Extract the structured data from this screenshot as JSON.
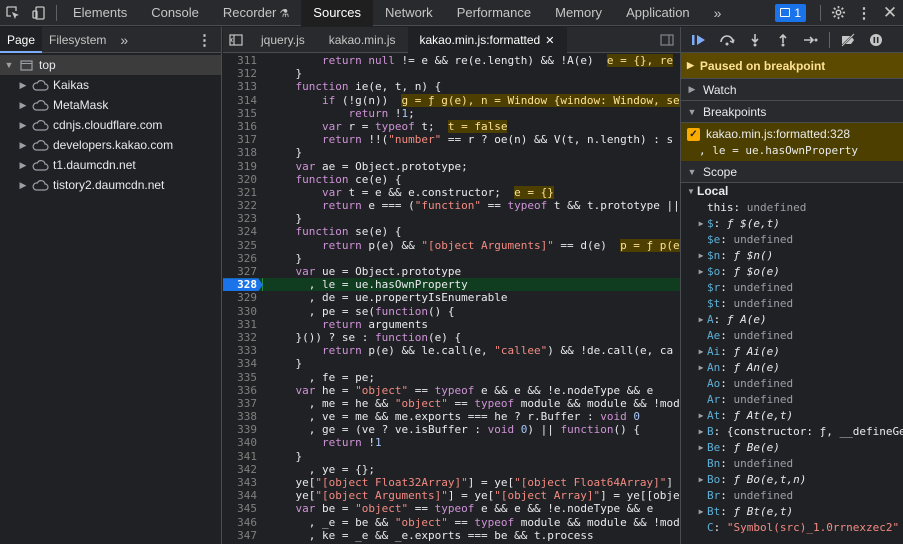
{
  "toolbar": {
    "tabs": [
      "Elements",
      "Console",
      "Recorder",
      "Sources",
      "Network",
      "Performance",
      "Memory",
      "Application"
    ],
    "active": "Sources",
    "issues_count": "1"
  },
  "navigator": {
    "tabs": [
      "Page",
      "Filesystem"
    ],
    "active": "Page",
    "tree": [
      {
        "label": "top",
        "level": 0,
        "icon": "frame"
      },
      {
        "label": "Kaikas",
        "level": 1,
        "icon": "cloud"
      },
      {
        "label": "MetaMask",
        "level": 1,
        "icon": "cloud"
      },
      {
        "label": "cdnjs.cloudflare.com",
        "level": 1,
        "icon": "cloud"
      },
      {
        "label": "developers.kakao.com",
        "level": 1,
        "icon": "cloud"
      },
      {
        "label": "t1.daumcdn.net",
        "level": 1,
        "icon": "cloud"
      },
      {
        "label": "tistory2.daumcdn.net",
        "level": 1,
        "icon": "cloud"
      }
    ]
  },
  "editor": {
    "tabs": [
      "jquery.js",
      "kakao.min.js",
      "kakao.min.js:formatted"
    ],
    "active": "kakao.min.js:formatted",
    "current_line": 328,
    "lines": [
      {
        "n": 311,
        "t": "        return null != e && re(e.length) && !A(e)  e = {}, re"
      },
      {
        "n": 312,
        "t": "    }"
      },
      {
        "n": 313,
        "t": "    function ie(e, t, n) {"
      },
      {
        "n": 314,
        "t": "        if (!g(n))  g = ƒ g(e), n = Window {window: Window, se"
      },
      {
        "n": 315,
        "t": "            return !1;"
      },
      {
        "n": 316,
        "t": "        var r = typeof t;  t = false"
      },
      {
        "n": 317,
        "t": "        return !!(\"number\" == r ? oe(n) && V(t, n.length) : \"s"
      },
      {
        "n": 318,
        "t": "    }"
      },
      {
        "n": 319,
        "t": "    var ae = Object.prototype;"
      },
      {
        "n": 320,
        "t": "    function ce(e) {"
      },
      {
        "n": 321,
        "t": "        var t = e && e.constructor;  e = {}"
      },
      {
        "n": 322,
        "t": "        return e === (\"function\" == typeof t && t.prototype ||"
      },
      {
        "n": 323,
        "t": "    }"
      },
      {
        "n": 324,
        "t": "    function se(e) {"
      },
      {
        "n": 325,
        "t": "        return p(e) && \"[object Arguments]\" == d(e)  p = ƒ p(e"
      },
      {
        "n": 326,
        "t": "    }"
      },
      {
        "n": 327,
        "t": "    var ue = Object.prototype"
      },
      {
        "n": 328,
        "t": "      , le = ue.hasOwnProperty"
      },
      {
        "n": 329,
        "t": "      , de = ue.propertyIsEnumerable"
      },
      {
        "n": 330,
        "t": "      , pe = se(function() {"
      },
      {
        "n": 331,
        "t": "        return arguments"
      },
      {
        "n": 332,
        "t": "    }()) ? se : function(e) {"
      },
      {
        "n": 333,
        "t": "        return p(e) && le.call(e, \"callee\") && !de.call(e, \"ca"
      },
      {
        "n": 334,
        "t": "    }"
      },
      {
        "n": 335,
        "t": "      , fe = pe;"
      },
      {
        "n": 336,
        "t": "    var he = \"object\" == typeof e && e && !e.nodeType && e"
      },
      {
        "n": 337,
        "t": "      , me = he && \"object\" == typeof module && module && !mod"
      },
      {
        "n": 338,
        "t": "      , ve = me && me.exports === he ? r.Buffer : void 0"
      },
      {
        "n": 339,
        "t": "      , ge = (ve ? ve.isBuffer : void 0) || function() {"
      },
      {
        "n": 340,
        "t": "        return !1"
      },
      {
        "n": 341,
        "t": "    }"
      },
      {
        "n": 342,
        "t": "      , ye = {};"
      },
      {
        "n": 343,
        "t": "    ye[\"[object Float32Array]\"] = ye[\"[object Float64Array]\"] ="
      },
      {
        "n": 344,
        "t": "    ye[\"[object Arguments]\"] = ye[\"[object Array]\"] = ye[\"[obje"
      },
      {
        "n": 345,
        "t": "    var be = \"object\" == typeof e && e && !e.nodeType && e"
      },
      {
        "n": 346,
        "t": "      , _e = be && \"object\" == typeof module && module && !mod"
      },
      {
        "n": 347,
        "t": "      , ke = _e && _e.exports === be && t.process"
      },
      {
        "n": 348,
        "t": "      , we = function() {"
      }
    ]
  },
  "debugger": {
    "paused_text": "Paused on breakpoint",
    "sections": {
      "watch": "Watch",
      "breakpoints": "Breakpoints",
      "scope": "Scope"
    },
    "breakpoint": {
      "label": "kakao.min.js:formatted:328",
      "snippet": ", le = ue.hasOwnProperty"
    },
    "scope_group": "Local",
    "scope": [
      {
        "k": "this",
        "v": "undefined",
        "exp": false,
        "kind": "und"
      },
      {
        "k": "$",
        "v": "ƒ $(e,t)",
        "exp": true,
        "kind": "fn"
      },
      {
        "k": "$e",
        "v": "undefined",
        "exp": false,
        "kind": "und"
      },
      {
        "k": "$n",
        "v": "ƒ $n()",
        "exp": true,
        "kind": "fn"
      },
      {
        "k": "$o",
        "v": "ƒ $o(e)",
        "exp": true,
        "kind": "fn"
      },
      {
        "k": "$r",
        "v": "undefined",
        "exp": false,
        "kind": "und"
      },
      {
        "k": "$t",
        "v": "undefined",
        "exp": false,
        "kind": "und"
      },
      {
        "k": "A",
        "v": "ƒ A(e)",
        "exp": true,
        "kind": "fn"
      },
      {
        "k": "Ae",
        "v": "undefined",
        "exp": false,
        "kind": "und"
      },
      {
        "k": "Ai",
        "v": "ƒ Ai(e)",
        "exp": true,
        "kind": "fn"
      },
      {
        "k": "An",
        "v": "ƒ An(e)",
        "exp": true,
        "kind": "fn"
      },
      {
        "k": "Ao",
        "v": "undefined",
        "exp": false,
        "kind": "und"
      },
      {
        "k": "Ar",
        "v": "undefined",
        "exp": false,
        "kind": "und"
      },
      {
        "k": "At",
        "v": "ƒ At(e,t)",
        "exp": true,
        "kind": "fn"
      },
      {
        "k": "B",
        "v": "{constructor: ƒ, __defineGe",
        "exp": true,
        "kind": "obj"
      },
      {
        "k": "Be",
        "v": "ƒ Be(e)",
        "exp": true,
        "kind": "fn"
      },
      {
        "k": "Bn",
        "v": "undefined",
        "exp": false,
        "kind": "und"
      },
      {
        "k": "Bo",
        "v": "ƒ Bo(e,t,n)",
        "exp": true,
        "kind": "fn"
      },
      {
        "k": "Br",
        "v": "undefined",
        "exp": false,
        "kind": "und"
      },
      {
        "k": "Bt",
        "v": "ƒ Bt(e,t)",
        "exp": true,
        "kind": "fn"
      },
      {
        "k": "C",
        "v": "\"Symbol(src)_1.0rrnexzec2\"",
        "exp": false,
        "kind": "str"
      }
    ]
  }
}
